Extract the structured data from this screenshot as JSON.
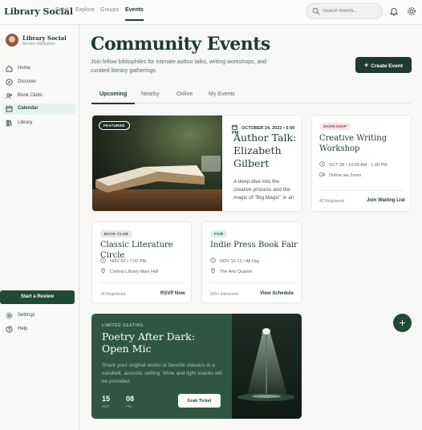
{
  "app": {
    "brand": "Library Social"
  },
  "topnav": {
    "items": [
      "Feed",
      "Explore",
      "Groups",
      "Events"
    ],
    "active": "Events"
  },
  "search": {
    "placeholder": "Search events..."
  },
  "user": {
    "name": "Library Social",
    "subtitle": "Modern Bibliophile"
  },
  "sidebar": {
    "items": [
      {
        "label": "Home",
        "icon": "home-icon"
      },
      {
        "label": "Discover",
        "icon": "compass-icon"
      },
      {
        "label": "Book Clubs",
        "icon": "group-icon"
      },
      {
        "label": "Calendar",
        "icon": "calendar-icon",
        "active": true
      },
      {
        "label": "Library",
        "icon": "library-icon"
      }
    ],
    "review_button": "Start a Review",
    "settings": "Settings",
    "help": "Help"
  },
  "page": {
    "title": "Community Events",
    "subtitle": "Join fellow bibliophiles for intimate author talks, writing workshops, and curated literary gatherings.",
    "create_button": "Create Event"
  },
  "tabs": [
    "Upcoming",
    "Nearby",
    "Online",
    "My Events"
  ],
  "featured": {
    "badge": "FEATURED",
    "date": "OCTOBER 24, 2023 • 6:00 PM",
    "title": "Author Talk: Elizabeth Gilbert",
    "description": "A deep dive into the creative process and the magic of \"Big Magic\" in an"
  },
  "workshop": {
    "badge": "WORKSHOP",
    "title": "Creative Writing Workshop",
    "datetime": "OCT 28 • 10:00 AM - 1:00 PM",
    "location": "Online via Zoom",
    "registered": "42 Registered",
    "action": "Join Waiting List"
  },
  "bookclub": {
    "badge": "BOOK CLUB",
    "title": "Classic Literature Circle",
    "datetime": "NOV 02 • 7:00 PM",
    "location": "Central Library Main Hall",
    "registered": "18 Registered",
    "action": "RSVP Now"
  },
  "fair": {
    "badge": "FAIR",
    "title": "Indie Press Book Fair",
    "datetime": "NOV 10-12 • All Day",
    "location": "The Arts Quarter",
    "registered": "500+ Interested",
    "action": "View Schedule"
  },
  "promo": {
    "eyebrow": "LIMITED SEATING",
    "title": "Poetry After Dark: Open Mic",
    "description": "Share your original works or favorite classics in a candlelit, acoustic setting. Wine and light snacks will be provided.",
    "dates": [
      {
        "day": "15",
        "month": "NOV"
      },
      {
        "day": "08",
        "month": "PM"
      }
    ],
    "button": "Grab Ticket"
  },
  "colors": {
    "primary": "#1f3a30",
    "accent": "#1f4a37",
    "promo_bg": "#2f5643"
  }
}
